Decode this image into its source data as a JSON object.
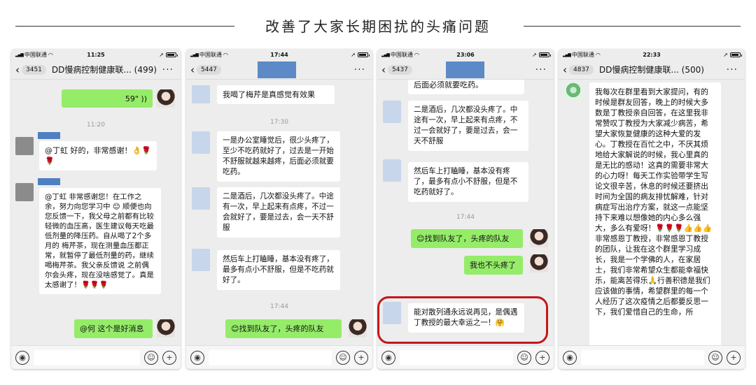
{
  "banner": {
    "title": "改善了大家长期困扰的头痛问题"
  },
  "phones": [
    {
      "status": {
        "carrier": "中国联通",
        "time": "11:25"
      },
      "nav": {
        "count": "3451",
        "title": "DD慢病控制健康联... (499)"
      },
      "messages": {
        "voice": "59\"",
        "time1": "11:20",
        "m1": "@丁虹 好的，非常感谢！👌🌹🌹",
        "m2": "@丁虹 非常感谢您！在工作之余，努力向您学习中 😊 顺便也向您反馈一下，我父母之前都有比较轻微的血压高，医生建议每天吃最低剂量的降压药。自从喝了2个多月的 梅芹茶，现在测量血压都正常，就暂停了最低剂量的药，继续喝梅芹茶。我父亲反馈说 之前偶尔会头疼，现在没啥感觉了。真是太感谢了！🌹🌹🌹",
        "m3": "@何 这个是好消息"
      }
    },
    {
      "status": {
        "carrier": "中国联通",
        "time": "17:44"
      },
      "nav": {
        "count": "5447"
      },
      "messages": {
        "m1": "我喝了梅芹是真感觉有效果",
        "time1": "17:30",
        "m2": "一是办公室睡觉后，很少头疼了，至少不吃药就好了，过去是一开始不舒服就越来越疼，后面必须就要吃药。",
        "m3": "二是酒后，几次都没头疼了。中途有一次，早上起来有点疼，不过一会就好了，要是过去，会一天不舒服",
        "m4": "然后车上打瞌睡，基本没有疼了，最多有点小不舒服，但是不吃药就好了。",
        "time2": "17:44",
        "m5": "😊找到队友了，头疼的队友"
      }
    },
    {
      "status": {
        "carrier": "中国联通",
        "time": "23:06"
      },
      "nav": {
        "count": "5437"
      },
      "messages": {
        "m0": "后面必须就要吃药。",
        "m1": "二是酒后，几次都没头疼了。中途有一次，早上起来有点疼，不过一会就好了，要是过去，会一天不舒服",
        "m2": "然后车上打瞌睡，基本没有疼了，最多有点小不舒服，但是不吃药就好了。",
        "time1": "17:44",
        "m3": "😊找到队友了，头疼的队友",
        "m4": "我也不头疼了",
        "m5": "能对散列通永远说再见，是偶遇丁教授的最大幸运之一！🤗"
      }
    },
    {
      "status": {
        "carrier": "中国联通",
        "time": "22:33"
      },
      "nav": {
        "count": "4837",
        "title": "DD慢病控制健康联... (500)"
      },
      "messages": {
        "m1": "我每次在群里看到大家提问，有的时候是群友回答，晚上的时候大多数是丁教授亲自回答，在这里我非常赞叹丁教授为大家减少病苦，希望大家恢复健康的这种大爱的发心。丁教授在百忙之中，不厌其烦地给大家解说的时候，我心里真的是无比的感动！这真的需要非常大的心力呀！每天工作实验带学生写论文很辛苦，休息的时候还要挤出时间为全国的病友排忧解难，针对病症写出治疗方案，就这一点能坚持下来难以想像她的内心多么强大，多么有爱呀！🌹🌹🌹👍👍👍\n    非常感恩丁教授，非常感恩丁教授的团队，让我在这个群里学习成长，我是一个学佛的人，在家居士，我们非常希望众生都能幸福快乐，能离苦得乐🙏行善积德是我们应该做的事情，希望群里的每一个人经历了这次疫情之后都要反思一下，我们爱惜自己的生命，所"
      }
    }
  ]
}
